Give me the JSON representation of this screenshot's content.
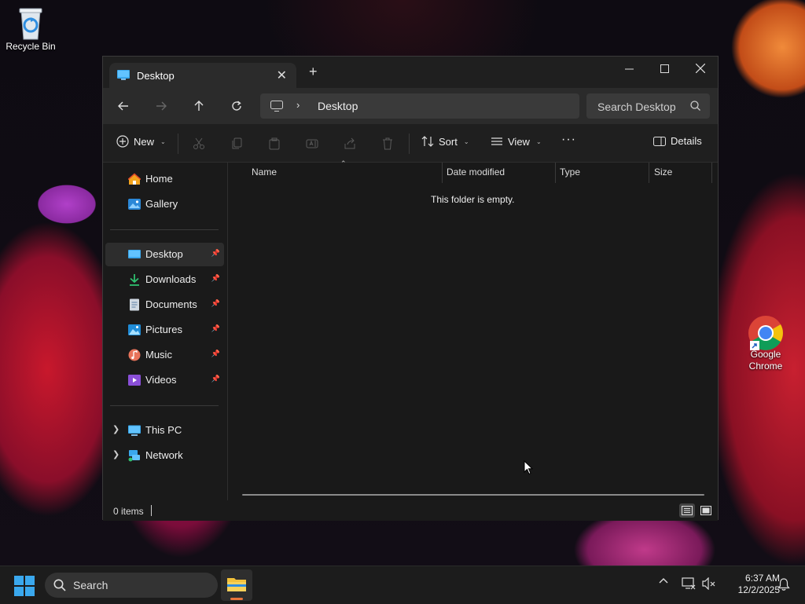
{
  "desktop": {
    "icons": [
      {
        "label": "Recycle Bin"
      },
      {
        "label": "Google Chrome"
      }
    ]
  },
  "window": {
    "tab_title": "Desktop",
    "new_tab_symbol": "+",
    "address": {
      "crumb": "Desktop"
    },
    "search_placeholder": "Search Desktop",
    "commands": {
      "new_label": "New",
      "sort_label": "Sort",
      "view_label": "View",
      "more_label": "···",
      "details_label": "Details"
    },
    "sidebar": {
      "top": [
        {
          "label": "Home",
          "icon": "home-icon"
        },
        {
          "label": "Gallery",
          "icon": "gallery-icon"
        }
      ],
      "quick": [
        {
          "label": "Desktop",
          "icon": "desktop-folder-icon"
        },
        {
          "label": "Downloads",
          "icon": "downloads-icon"
        },
        {
          "label": "Documents",
          "icon": "documents-icon"
        },
        {
          "label": "Pictures",
          "icon": "pictures-icon"
        },
        {
          "label": "Music",
          "icon": "music-icon"
        },
        {
          "label": "Videos",
          "icon": "videos-icon"
        }
      ],
      "bottom": [
        {
          "label": "This PC",
          "icon": "this-pc-icon"
        },
        {
          "label": "Network",
          "icon": "network-icon"
        }
      ]
    },
    "columns": [
      "Name",
      "Date modified",
      "Type",
      "Size"
    ],
    "empty_message": "This folder is empty.",
    "status": {
      "item_count": "0 items"
    }
  },
  "taskbar": {
    "search_label": "Search",
    "time": "6:37 AM",
    "date": "12/2/2025"
  },
  "colors": {
    "accent": "#e8743a",
    "folder_yellow": "#f3c13a",
    "windows_blue": "#3aa8ee"
  }
}
